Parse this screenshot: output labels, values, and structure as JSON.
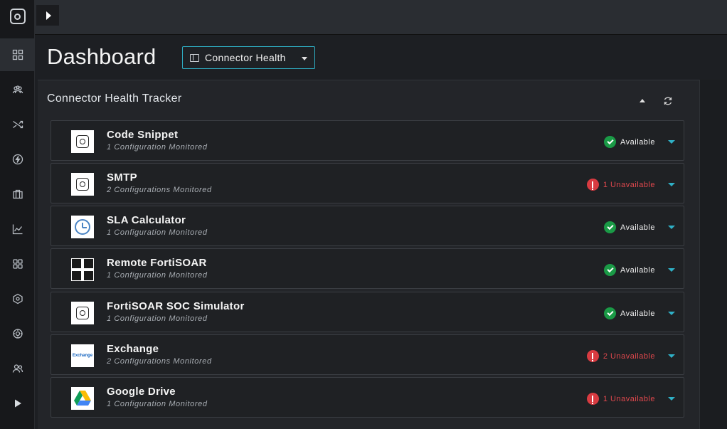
{
  "header": {
    "page_title": "Dashboard",
    "dashboard_select": "Connector Health"
  },
  "panel": {
    "title": "Connector Health Tracker"
  },
  "colors": {
    "accent": "#2fb0c6",
    "available": "#1a9a46",
    "unavailable": "#d83b41"
  },
  "sidebar": {
    "items": [
      {
        "icon": "dashboard-icon"
      },
      {
        "icon": "people-icon"
      },
      {
        "icon": "shuffle-icon"
      },
      {
        "icon": "lightning-icon"
      },
      {
        "icon": "briefcase-icon"
      },
      {
        "icon": "chart-icon"
      },
      {
        "icon": "apps-icon"
      },
      {
        "icon": "cube-icon"
      },
      {
        "icon": "gear-icon"
      },
      {
        "icon": "users-icon"
      },
      {
        "icon": "play-icon"
      }
    ]
  },
  "connectors": [
    {
      "name": "Code Snippet",
      "sub": "1 Configuration Monitored",
      "status": "Available",
      "ok": true
    },
    {
      "name": "SMTP",
      "sub": "2 Configurations Monitored",
      "status": "1 Unavailable",
      "ok": false
    },
    {
      "name": "SLA Calculator",
      "sub": "1 Configuration Monitored",
      "status": "Available",
      "ok": true
    },
    {
      "name": "Remote FortiSOAR",
      "sub": "1 Configuration Monitored",
      "status": "Available",
      "ok": true
    },
    {
      "name": "FortiSOAR SOC Simulator",
      "sub": "1 Configuration Monitored",
      "status": "Available",
      "ok": true
    },
    {
      "name": "Exchange",
      "sub": "2 Configurations Monitored",
      "status": "2 Unavailable",
      "ok": false,
      "logo_text": "Exchange"
    },
    {
      "name": "Google Drive",
      "sub": "1 Configuration Monitored",
      "status": "1 Unavailable",
      "ok": false
    }
  ]
}
